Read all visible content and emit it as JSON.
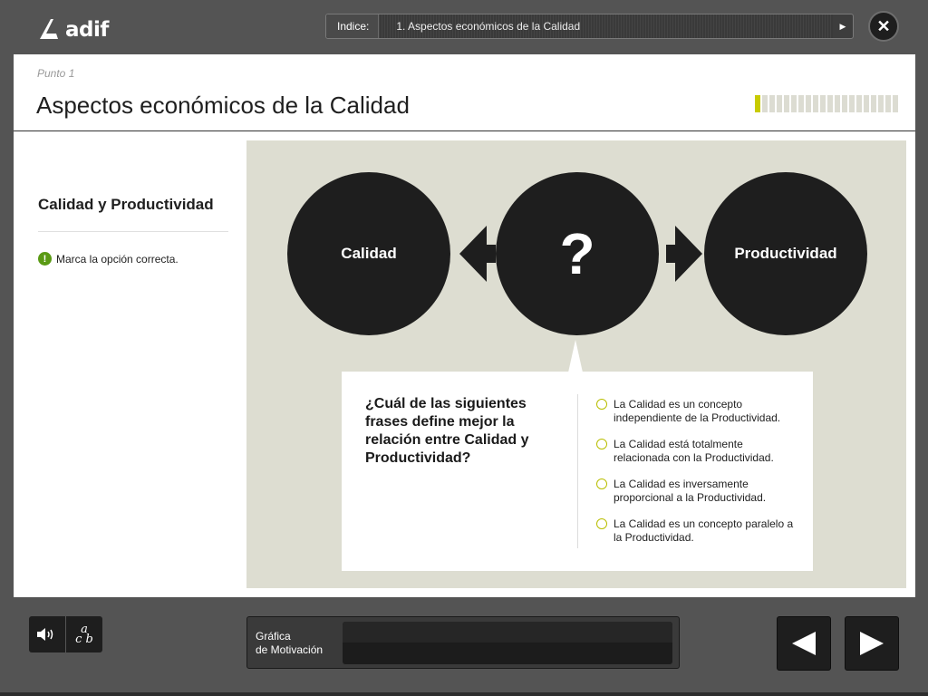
{
  "header": {
    "logo_text": "adif",
    "index_label": "Indice:",
    "index_value": "1. Aspectos económicos de la Calidad"
  },
  "page": {
    "point_label": "Punto 1",
    "title": "Aspectos económicos de la Calidad",
    "progress": {
      "current": 1,
      "total": 20
    }
  },
  "sidebar": {
    "section_title": "Calidad y Productividad",
    "instruction": "Marca la opción correcta."
  },
  "diagram": {
    "left": "Calidad",
    "center": "?",
    "right": "Productividad"
  },
  "quiz": {
    "question": "¿Cuál de las siguientes frases define mejor la relación entre Calidad y Productividad?",
    "options": [
      "La Calidad es un concepto independiente de la Productividad.",
      "La Calidad está totalmente relacionada con la Productividad.",
      "La Calidad es inversamente proporcional a la Productividad.",
      "La Calidad es un concepto paralelo a la Productividad."
    ]
  },
  "footer": {
    "motivation_line1": "Gráfica",
    "motivation_line2": "de Motivación"
  },
  "icons": {
    "audio": "speaker-icon",
    "glossary": "glossary-icon",
    "close": "close-icon",
    "prev": "arrow-left-icon",
    "next": "arrow-right-icon"
  },
  "colors": {
    "accent": "#c8cb00",
    "alert": "#5a9a14",
    "stage_bg": "#ddddd1",
    "dark": "#1e1e1e"
  }
}
